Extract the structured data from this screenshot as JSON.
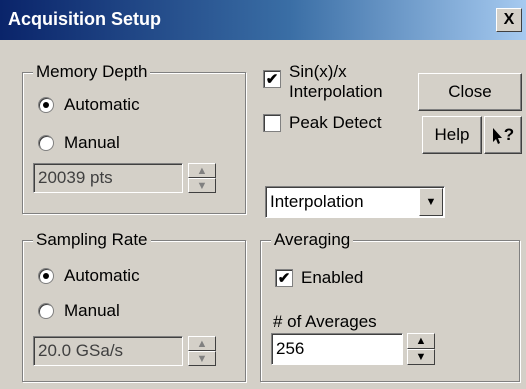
{
  "window": {
    "title": "Acquisition Setup",
    "close_glyph": "X"
  },
  "memory_depth": {
    "legend": "Memory Depth",
    "automatic_label": "Automatic",
    "manual_label": "Manual",
    "selected": "Automatic",
    "value": "20039 pts"
  },
  "sampling_rate": {
    "legend": "Sampling Rate",
    "automatic_label": "Automatic",
    "manual_label": "Manual",
    "selected": "Automatic",
    "value": "20.0 GSa/s"
  },
  "options": {
    "sinx_label_line1": "Sin(x)/x",
    "sinx_label_line2": "Interpolation",
    "sinx_checked": true,
    "peak_label": "Peak Detect",
    "peak_checked": false,
    "mode_selected": "Interpolation"
  },
  "buttons": {
    "close": "Close",
    "help": "Help",
    "whatsthis": "?"
  },
  "averaging": {
    "legend": "Averaging",
    "enabled_label": "Enabled",
    "enabled_checked": true,
    "count_label": "# of Averages",
    "count_value": "256"
  }
}
